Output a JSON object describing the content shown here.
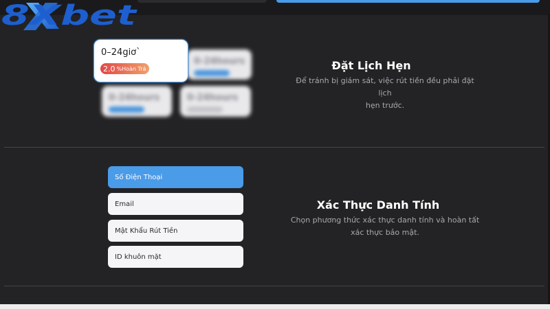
{
  "brand": {
    "logo_text": "8Xbet",
    "accent_color": "#4a9be8",
    "logo_color": "#1e5fcf"
  },
  "schedule": {
    "cards": [
      {
        "hours": "0–24giơ`",
        "rate": "2.0",
        "rate_unit": "%Hoàn Trả",
        "selected": true
      },
      {
        "hours": "0-24hours",
        "selected": false
      },
      {
        "hours": "0-24hours",
        "selected": false
      },
      {
        "hours": "0-24hours",
        "selected": false
      }
    ],
    "title": "Đặt Lịch Hẹn",
    "description_line1": "Để tránh bị giám sát, việc rút tiền đều phải đặt lịch",
    "description_line2": "hẹn trước."
  },
  "identity": {
    "options": [
      {
        "label": "Số Điện Thoại",
        "selected": true
      },
      {
        "label": "Email",
        "selected": false
      },
      {
        "label": "Mật Khẩu Rút Tiền",
        "selected": false
      },
      {
        "label": "ID khuôn mặt",
        "selected": false
      }
    ],
    "title": "Xác Thực Danh Tính",
    "description_line1": "Chọn phương thức xác thực danh tính và hoàn tất",
    "description_line2": "xác thực bảo mật."
  }
}
